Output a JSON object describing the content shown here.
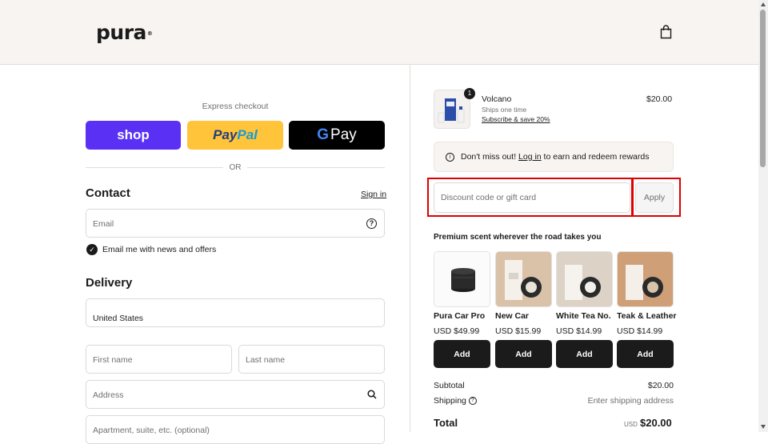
{
  "header": {
    "logo_text": "pura",
    "logo_mark": "®",
    "cart_icon": "shopping-bag-icon"
  },
  "express": {
    "label": "Express checkout",
    "shop_label": "shop",
    "paypal_label_a": "Pay",
    "paypal_label_b": "Pal",
    "gpay_g": "G",
    "gpay_label": "Pay",
    "or": "OR"
  },
  "contact": {
    "title": "Contact",
    "signin": "Sign in",
    "email_placeholder": "Email",
    "newsletter_label": "Email me with news and offers",
    "newsletter_checked": true
  },
  "delivery": {
    "title": "Delivery",
    "country": "United States",
    "first_name_placeholder": "First name",
    "last_name_placeholder": "Last name",
    "address_placeholder": "Address",
    "apartment_placeholder": "Apartment, suite, etc. (optional)"
  },
  "order": {
    "item": {
      "quantity": "1",
      "name": "Volcano",
      "ships": "Ships one time",
      "subscribe": "Subscribe & save 20%",
      "price": "$20.00"
    },
    "rewards": {
      "prefix": "Don't miss out! ",
      "link": "Log in",
      "suffix": " to earn and redeem rewards"
    },
    "discount_placeholder": "Discount code or gift card",
    "apply_label": "Apply",
    "promo_title": "Premium scent wherever the road takes you",
    "products": [
      {
        "name": "Pura Car Pro",
        "price": "USD $49.99",
        "add": "Add"
      },
      {
        "name": "New Car",
        "price": "USD $15.99",
        "add": "Add"
      },
      {
        "name": "White Tea No.",
        "price": "USD $14.99",
        "add": "Add"
      },
      {
        "name": "Teak & Leather",
        "price": "USD $14.99",
        "add": "Add"
      }
    ],
    "summary": {
      "subtotal_label": "Subtotal",
      "subtotal_value": "$20.00",
      "shipping_label": "Shipping",
      "shipping_value": "Enter shipping address",
      "total_label": "Total",
      "currency": "USD",
      "total_value": "$20.00"
    }
  },
  "colors": {
    "shop": "#5a31f4",
    "paypal": "#ffc439",
    "gpay": "#000000",
    "highlight": "#e00000",
    "header_bg": "#f8f4f1"
  }
}
